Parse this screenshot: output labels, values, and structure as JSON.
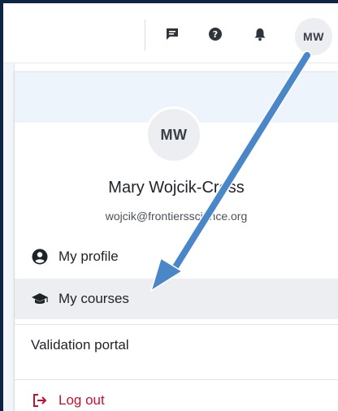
{
  "topbar": {
    "icons": [
      "chat-icon",
      "help-icon",
      "bell-icon"
    ],
    "avatar_initials": "MW"
  },
  "menu": {
    "avatar_initials": "MW",
    "user_name": "Mary Wojcik-Cross",
    "user_email": "wojcik@frontiersscience.org",
    "items": [
      {
        "label": "My profile",
        "icon": "user-circle-icon"
      },
      {
        "label": "My courses",
        "icon": "graduation-cap-icon",
        "highlighted": true
      },
      {
        "label": "Validation portal"
      },
      {
        "label": "Log out",
        "icon": "logout-icon"
      }
    ]
  },
  "colors": {
    "background": "#0f2444",
    "arrow": "#4a87c9",
    "logout": "#c8102e",
    "highlight": "#eceef1"
  }
}
